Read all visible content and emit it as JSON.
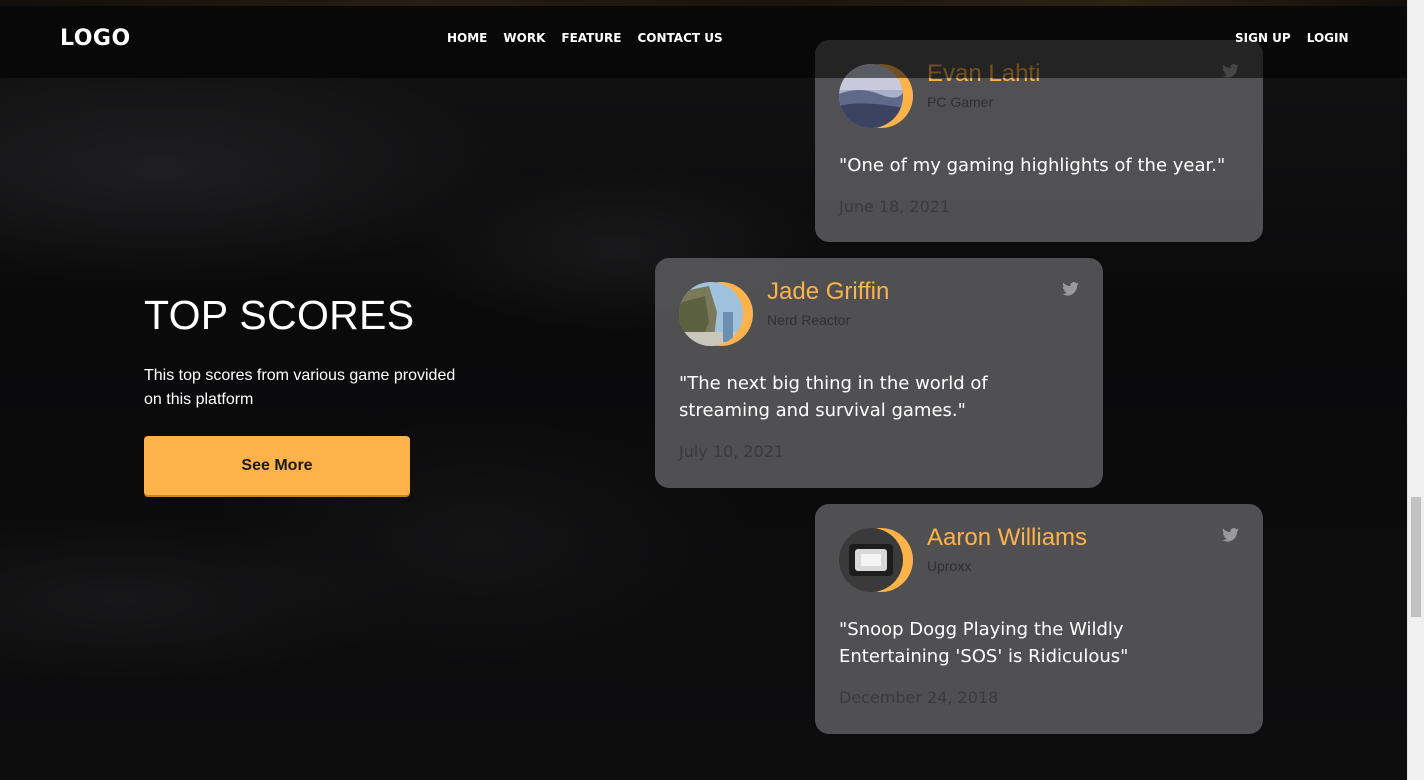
{
  "nav": {
    "logo": "LOGO",
    "links": [
      "HOME",
      "WORK",
      "FEATURE",
      "CONTACT US"
    ],
    "auth": [
      "SIGN UP",
      "LOGIN"
    ]
  },
  "hero": {
    "title": "TOP SCORES",
    "description": "This top scores from various game provided on this platform",
    "button": "See More"
  },
  "colors": {
    "accent": "#fdb24a",
    "card_bg": "#565658",
    "page_bg": "#0b0b0c"
  },
  "reviews": [
    {
      "name": "Evan Lahti",
      "outlet": "PC Gamer",
      "quote": "\"One of my gaming highlights of the year.\"",
      "date": "June 18, 2021",
      "icon": "twitter-icon"
    },
    {
      "name": "Jade Griffin",
      "outlet": "Nerd Reactor",
      "quote": "\"The next big thing in the world of streaming and survival games.\"",
      "date": "July 10, 2021",
      "icon": "twitter-icon"
    },
    {
      "name": "Aaron Williams",
      "outlet": "Uproxx",
      "quote": "\"Snoop Dogg Playing the Wildly Entertaining 'SOS' is Ridiculous\"",
      "date": "December 24, 2018",
      "icon": "twitter-icon"
    }
  ]
}
